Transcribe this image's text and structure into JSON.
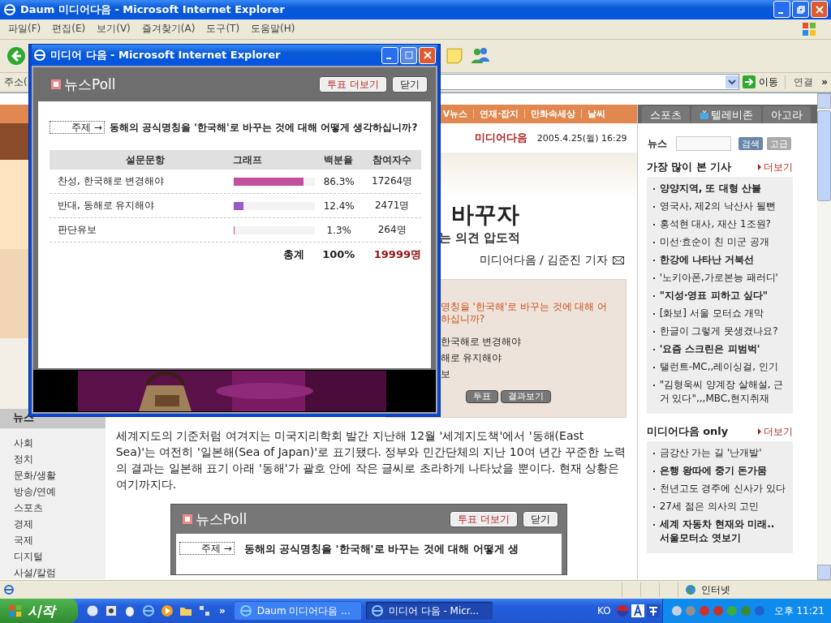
{
  "window": {
    "title": "Daum 미디어다음 - Microsoft Internet Explorer"
  },
  "menu": [
    "파일(F)",
    "편집(E)",
    "보기(V)",
    "즐겨찾기(A)",
    "도구(T)",
    "도움말(H)"
  ],
  "address_bar": {
    "label": "주소(",
    "go": "이동",
    "links": "연결",
    "chevron": "»"
  },
  "page": {
    "nav_tabs": [
      "V뉴스",
      "연재·잡지",
      "만화속세상",
      "날씨"
    ],
    "brand": "미디어다음",
    "date": "2005.4.25(월) 16:29",
    "headline": "바꾸자",
    "subheadline": "는 의견 압도적",
    "byline": "미디어다음 / 김준진 기자",
    "poll_box": {
      "question_lines": [
        "명칭을 '한국해'로 바꾸는 것에 대해 어",
        "하십니까?"
      ],
      "options": [
        "한국해로 변경해야",
        "해로 유지해야",
        "보"
      ],
      "buttons": [
        "투표",
        "결과보기"
      ]
    },
    "article": "세계지도의 기준처럼 여겨지는 미국지리학회 발간 지난해 12월 '세계지도책'에서 '동해(East Sea)'는 여전히 '일본해(Sea of Japan)'로 표기됐다. 정부와 민간단체의 지난 10여 년간 꾸준한 노력의 결과는 일본해 표기 아래 '동해'가 괄호 안에 작은 글씨로 초라하게 나타났을 뿐이다. 현재 상황은 여기까지다.",
    "embedded_poll": {
      "title": "뉴스Poll",
      "buttons": [
        {
          "label": "투표 더보기",
          "kind": "more"
        },
        {
          "label": "닫기",
          "kind": "close"
        }
      ],
      "topic": "주제 →",
      "question": "동해의 공식명칭을 '한국해'로 바꾸는 것에 대해 어떻게 생"
    },
    "left_menu": {
      "title": "뉴스",
      "items": [
        "사회",
        "정치",
        "문화/생활",
        "방송/연예",
        "스포츠",
        "경제",
        "국제",
        "디지털",
        "사설/칼럼"
      ]
    },
    "right": {
      "tabs": [
        "스포츠",
        "텔레비존",
        "아고라"
      ],
      "search": {
        "label": "뉴스",
        "buttons": [
          "검색",
          "고급"
        ]
      },
      "sections": [
        {
          "title": "가장 많이 본 기사",
          "more": "더보기",
          "items": [
            {
              "text": "양양지역, 또 대형 산불",
              "bold": true
            },
            {
              "text": "영국사, 제2의 낙산사 될뻔",
              "bold": false
            },
            {
              "text": "홍석현 대사, 재산 1조원?",
              "bold": false
            },
            {
              "text": "미선·효순이 친 미군 공개",
              "bold": false
            },
            {
              "text": "한강에 나타난 거북선",
              "bold": true
            },
            {
              "text": "'노키아폰,가로본능 패러디'",
              "bold": false
            },
            {
              "text": "\"지성·영표 피하고 싶다\"",
              "bold": true
            },
            {
              "text": "[화보] 서울 모터쇼 개막",
              "bold": false
            },
            {
              "text": "한글이 그렇게 못생겼나요?",
              "bold": false
            },
            {
              "text": "'요즘 스크린은 피범벅'",
              "bold": true
            },
            {
              "text": "탤런트-MC,,레이싱걸, 인기",
              "bold": false
            },
            {
              "text": "\"김형욱씨 양계장 살해설, 근거 있다\",,,MBC,현지취재",
              "bold": false
            }
          ]
        },
        {
          "title": "미디어다음 only",
          "more": "더보기",
          "items": [
            {
              "text": "금강산 가는 길 '난개발'",
              "bold": false
            },
            {
              "text": "은행 왕따에 중기 돈가뭄",
              "bold": true
            },
            {
              "text": "천년고도 경주에 신사가 있다",
              "bold": false
            },
            {
              "text": "27세 젊은 의사의 고민",
              "bold": false
            },
            {
              "text": "세계 자동차 현재와 미래.. 서울모터쇼 엿보기",
              "bold": true
            }
          ]
        }
      ]
    }
  },
  "popup": {
    "title": "미디어 다음 - Microsoft Internet Explorer",
    "poll": {
      "title": "뉴스Poll",
      "buttons": [
        {
          "label": "투표 더보기",
          "kind": "more"
        },
        {
          "label": "닫기",
          "kind": "close"
        }
      ],
      "topic": "주제 →",
      "question": "동해의 공식명칭을 '한국해'로 바꾸는 것에 대해 어떻게 생각하십니까?",
      "columns": [
        "설문문항",
        "그래프",
        "백분율",
        "참여자수"
      ],
      "rows": [
        {
          "option": "찬성, 한국해로 변경해야",
          "level": 0.863,
          "color": "#c2509c",
          "percent": "86.3%",
          "count": "17264명"
        },
        {
          "option": "반대, 동해로 유지해야",
          "level": 0.124,
          "color": "#9b59c9",
          "percent": "12.4%",
          "count": "2471명"
        },
        {
          "option": "판단유보",
          "level": 0.013,
          "color": "#c2509c",
          "percent": "1.3%",
          "count": "264명"
        }
      ],
      "total": {
        "label": "총계",
        "percent": "100%",
        "count": "19999명"
      }
    }
  },
  "status_bar": {
    "zone": "인터넷"
  },
  "taskbar": {
    "start": "시작",
    "chevron": "»",
    "tasks": [
      {
        "label": "Daum 미디어다음 ...",
        "selected": false
      },
      {
        "label": "미디어 다음 - Micr...",
        "selected": true
      }
    ],
    "language": "KO",
    "clock": "오후 11:21"
  }
}
